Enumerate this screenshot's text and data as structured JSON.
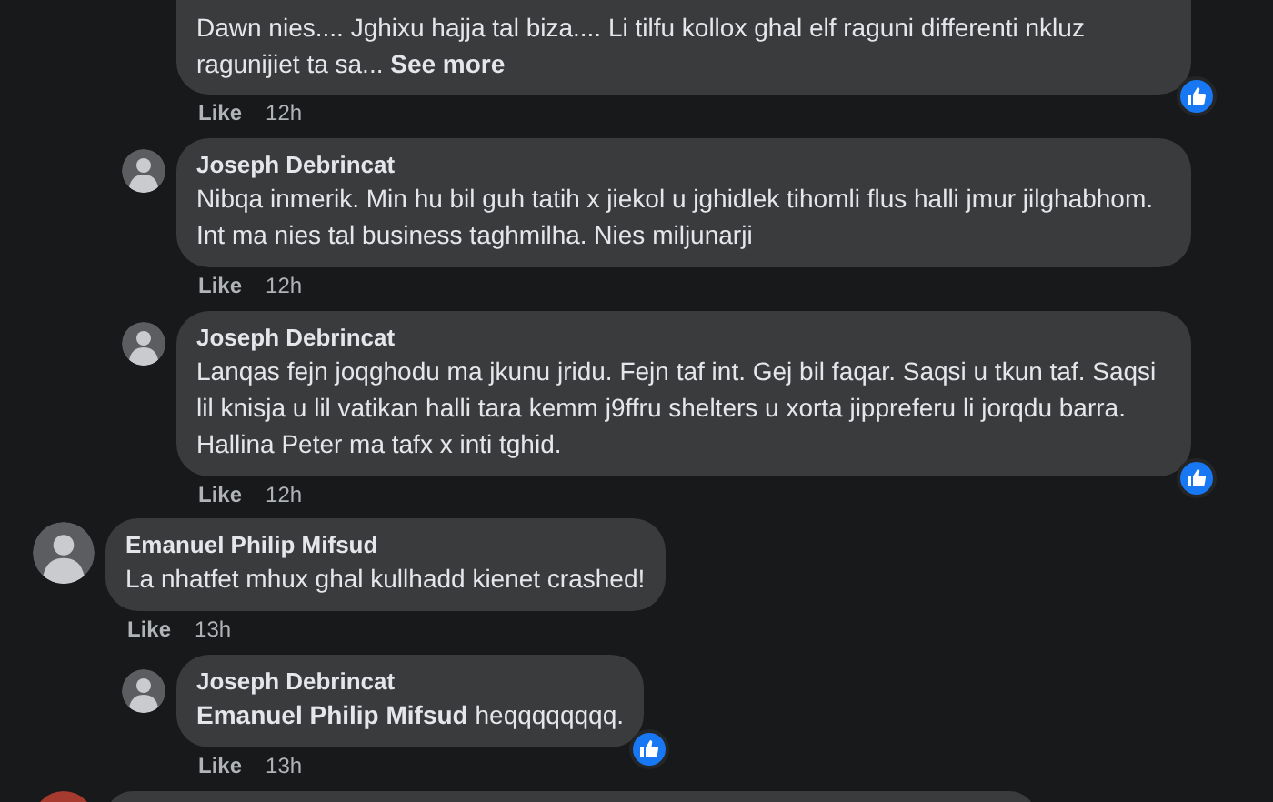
{
  "replies_above": [
    {
      "text": "Dawn nies.... Jghixu hajja tal biza.... Li tilfu kollox ghal elf raguni differenti nkluz ragunijiet ta sa...",
      "see_more": "See more",
      "liked": true,
      "like": "Like",
      "time": "12h"
    },
    {
      "author": "Joseph Debrincat",
      "text": "Nibqa inmerik. Min hu bil guh tatih x jiekol u jghidlek tihomli flus halli jmur jilghabhom. Int ma nies tal business taghmilha. Nies miljunarji",
      "liked": false,
      "like": "Like",
      "time": "12h"
    },
    {
      "author": "Joseph Debrincat",
      "text": "Lanqas fejn joqghodu ma jkunu jridu. Fejn taf int. Gej bil faqar. Saqsi u tkun taf. Saqsi lil knisja u lil vatikan halli tara kemm j9ffru shelters u xorta jippreferu li jorqdu barra. Hallina Peter ma tafx x inti tghid.",
      "liked": true,
      "like": "Like",
      "time": "12h"
    }
  ],
  "comments": [
    {
      "author": "Emanuel Philip Mifsud",
      "text": "La nhatfet mhux ghal kullhadd kienet crashed!",
      "liked": false,
      "like": "Like",
      "time": "13h",
      "children": [
        {
          "author": "Joseph Debrincat",
          "text": "**Emanuel Philip Mifsud** heqqqqqqqq.",
          "liked": true,
          "like": "Like",
          "time": "13h"
        }
      ]
    }
  ]
}
